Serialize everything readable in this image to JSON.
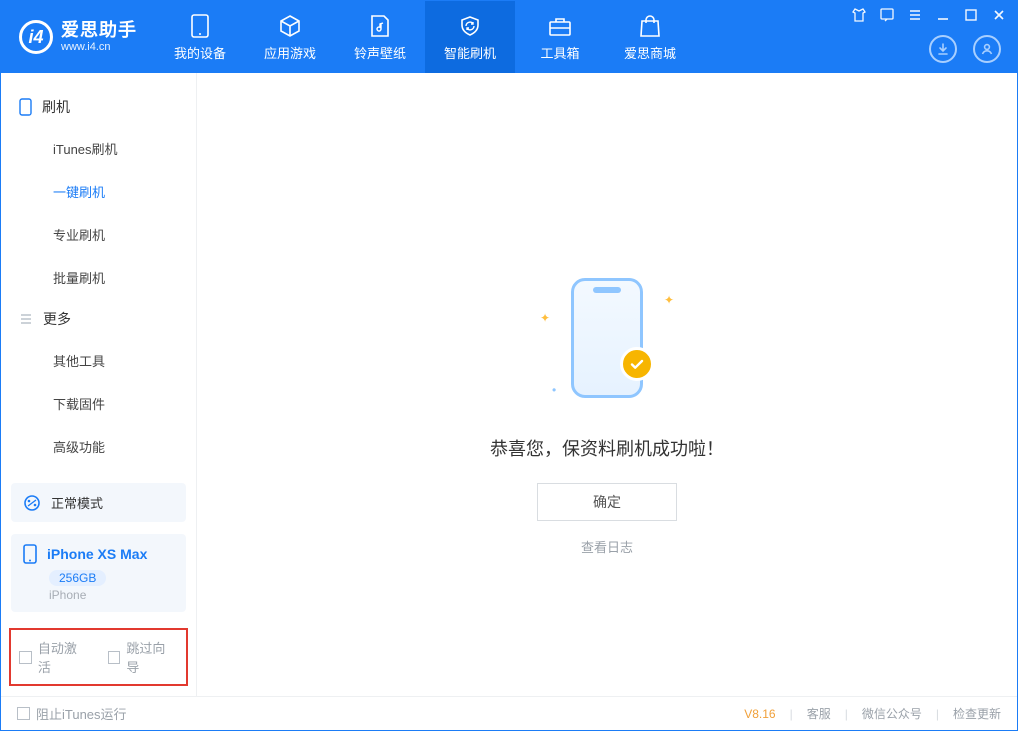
{
  "app": {
    "name_cn": "爱思助手",
    "name_en": "www.i4.cn"
  },
  "tabs": [
    {
      "label": "我的设备"
    },
    {
      "label": "应用游戏"
    },
    {
      "label": "铃声壁纸"
    },
    {
      "label": "智能刷机"
    },
    {
      "label": "工具箱"
    },
    {
      "label": "爱思商城"
    }
  ],
  "active_tab_index": 3,
  "sidebar": {
    "group1_title": "刷机",
    "group1_items": [
      "iTunes刷机",
      "一键刷机",
      "专业刷机",
      "批量刷机"
    ],
    "group1_active_index": 1,
    "group2_title": "更多",
    "group2_items": [
      "其他工具",
      "下载固件",
      "高级功能"
    ],
    "status_label": "正常模式",
    "device": {
      "name": "iPhone XS Max",
      "storage": "256GB",
      "type": "iPhone"
    },
    "check_auto_activate": "自动激活",
    "check_skip_guide": "跳过向导"
  },
  "main": {
    "success_message": "恭喜您，保资料刷机成功啦！",
    "ok_button": "确定",
    "view_log": "查看日志"
  },
  "footer": {
    "block_itunes": "阻止iTunes运行",
    "version": "V8.16",
    "links": [
      "客服",
      "微信公众号",
      "检查更新"
    ]
  }
}
